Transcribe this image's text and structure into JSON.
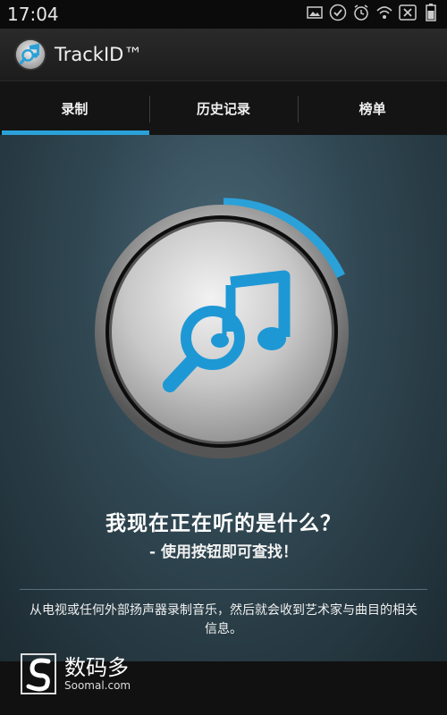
{
  "status_bar": {
    "time": "17:04",
    "icons": [
      "image-icon",
      "check-circle-icon",
      "alarm-icon",
      "wifi-icon",
      "no-sim-icon",
      "battery-icon"
    ]
  },
  "app_bar": {
    "title": "TrackID™",
    "logo_icon": "trackid-logo-icon"
  },
  "tabs": [
    {
      "label": "录制",
      "active": true
    },
    {
      "label": "历史记录",
      "active": false
    },
    {
      "label": "榜单",
      "active": false
    }
  ],
  "main": {
    "record_button_icon": "trackid-search-note-icon",
    "question": "我现在正在听的是什么？",
    "hint": "- 使用按钮即可查找！",
    "description": "从电视或任何外部扬声器录制音乐，然后就会收到艺术家与曲目的相关信息。"
  },
  "watermark": {
    "cn": "数码多",
    "en": "Soomal.com"
  },
  "colors": {
    "accent": "#2aa1d8",
    "background": "#304752",
    "tab_bar": "#141414"
  }
}
